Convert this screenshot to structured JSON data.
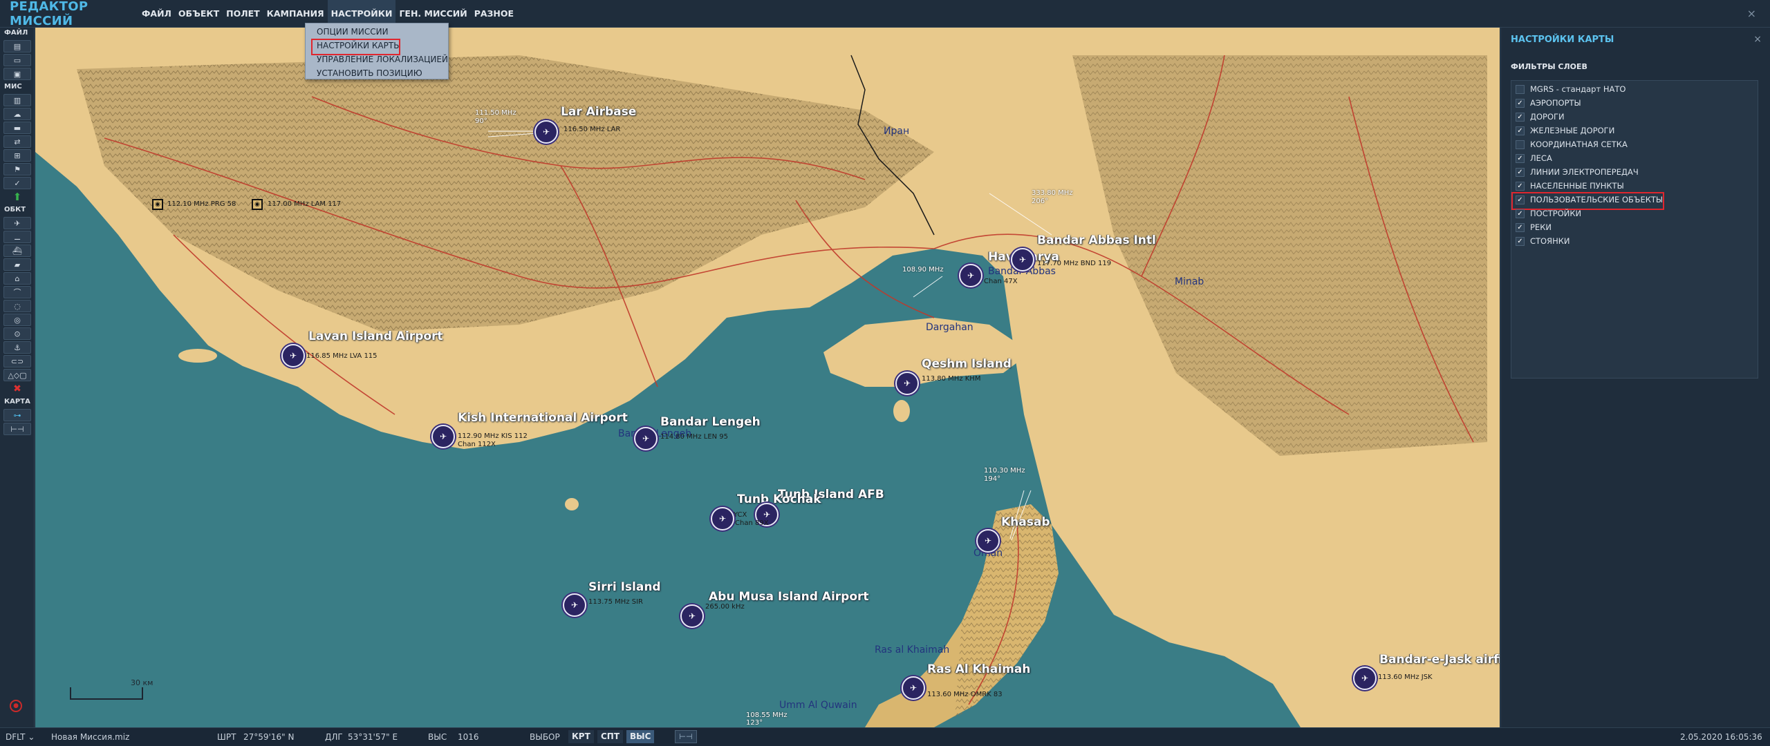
{
  "app": {
    "title": "РЕДАКТОР МИССИЙ",
    "close_glyph": "×"
  },
  "menu": {
    "items": [
      "ФАЙЛ",
      "ОБЪЕКТ",
      "ПОЛЕТ",
      "КАМПАНИЯ",
      "НАСТРОЙКИ",
      "ГЕН. МИССИЙ",
      "РАЗНОЕ"
    ],
    "active": "НАСТРОЙКИ"
  },
  "dropdown": {
    "items": [
      "ОПЦИИ МИССИИ",
      "НАСТРОЙКИ КАРТЫ",
      "УПРАВЛЕНИЕ ЛОКАЛИЗАЦИЕЙ",
      "УСТАНОВИТЬ ПОЗИЦИЮ"
    ],
    "highlighted": "НАСТРОЙКИ КАРТЫ"
  },
  "toolbar": {
    "sections": [
      {
        "label": "ФАЙЛ",
        "buttons": [
          "new-file-icon",
          "open-folder-icon",
          "save-icon"
        ]
      },
      {
        "label": "МИС",
        "buttons": [
          "trash-icon",
          "weather-icon",
          "briefing-icon",
          "trigger-icon",
          "resource-icon",
          "goal-icon",
          "check-icon"
        ]
      },
      {
        "label": "ОБКТ",
        "buttons": [
          "plane-icon",
          "helicopter-icon",
          "ship-icon",
          "tank-icon",
          "sam-icon",
          "static-icon",
          "zone-icon",
          "target-icon",
          "nav-point-icon",
          "airfield-icon",
          "link-icon",
          "shapes-icon"
        ]
      },
      {
        "label": "КАРТА",
        "buttons": [
          "map-layers-icon",
          "ruler-icon"
        ]
      }
    ],
    "glyphs": {
      "green": "⬆",
      "red": "✖",
      "shapes": "△◇▢"
    }
  },
  "map": {
    "places": [
      {
        "name": "Lar Airbase"
      },
      {
        "name": "Bandar Abbas Intl"
      },
      {
        "name": "Havadarya"
      },
      {
        "name": "Lavan Island Airport"
      },
      {
        "name": "Qeshm Island"
      },
      {
        "name": "Kish International Airport"
      },
      {
        "name": "Bandar Lengeh"
      },
      {
        "name": "Tunb Island AFB"
      },
      {
        "name": "Tunb Kochak"
      },
      {
        "name": "Khasab"
      },
      {
        "name": "Sirri Island"
      },
      {
        "name": "Abu Musa Island Airport"
      },
      {
        "name": "Ras Al Khaimah"
      },
      {
        "name": "Bandar-e-Jask airfi"
      }
    ],
    "towns": [
      {
        "name": "Иран"
      },
      {
        "name": "Dargahan"
      },
      {
        "name": "Minab"
      },
      {
        "name": "Ras al Khaimah"
      },
      {
        "name": "Umm Al Quwain"
      },
      {
        "name": "Oman"
      },
      {
        "name": "Bandar Abbas"
      },
      {
        "name": "Bandar Lengeh"
      }
    ],
    "frequencies": [
      "111.50 MHz",
      "90°",
      "116.50 MHz LAR",
      "112.10 MHz PRG 58",
      "117.00 MHz LAM 117",
      "333.80 MHz",
      "206°",
      "117.70 MHz BND 119",
      "108.90 MHz",
      "Chan 47X",
      "116.85 MHz LVA 115",
      "113.80 MHz KHM",
      "112.90 MHz KIS 112",
      "Chan 112X",
      "114.80 MHz LEN 95",
      "110.30 MHz",
      "194°",
      "Chan 89X",
      "113.75 MHz SIR",
      "265.00 kHz",
      "113.60 MHz OMRK 83",
      "108.55 MHz",
      "123°",
      "113.60 MHz JSK",
      "YCX"
    ],
    "scale_label": "30 км",
    "colors": {
      "sea": "#3a7d86",
      "land": "#e8c98c",
      "mountain": "#a9905f",
      "road": "#c0392b",
      "airport": "#2b2461"
    }
  },
  "panel": {
    "title": "НАСТРОЙКИ КАРТЫ",
    "close_glyph": "×",
    "subtitle": "ФИЛЬТРЫ СЛОЕВ",
    "check_glyph": "✓",
    "filters": [
      {
        "label": "MGRS - стандарт НАТО",
        "checked": false
      },
      {
        "label": "АЭРОПОРТЫ",
        "checked": true
      },
      {
        "label": "ДОРОГИ",
        "checked": true
      },
      {
        "label": "ЖЕЛЕЗНЫЕ ДОРОГИ",
        "checked": true
      },
      {
        "label": "КООРДИНАТНАЯ СЕТКА",
        "checked": false
      },
      {
        "label": "ЛЕСА",
        "checked": true
      },
      {
        "label": "ЛИНИИ ЭЛЕКТРОПЕРЕДАЧ",
        "checked": true
      },
      {
        "label": "НАСЕЛЕННЫЕ ПУНКТЫ",
        "checked": true
      },
      {
        "label": "ПОЛЬЗОВАТЕЛЬСКИЕ ОБЪЕКТЫ",
        "checked": true,
        "highlighted": true
      },
      {
        "label": "ПОСТРОЙКИ",
        "checked": true
      },
      {
        "label": "РЕКИ",
        "checked": true
      },
      {
        "label": "СТОЯНКИ",
        "checked": true
      }
    ]
  },
  "status": {
    "profile": "DFLT",
    "file": "Новая Миссия.miz",
    "lat_label": "ШРТ",
    "lat": "27°59'16\" N",
    "lon_label": "ДЛГ",
    "lon": "53°31'57\" E",
    "alt_label": "ВЫС",
    "alt": "1016",
    "select_label": "ВЫБОР",
    "modes": [
      "КРТ",
      "СПТ",
      "ВЫС"
    ],
    "active_mode": "ВЫС",
    "datetime": "2.05.2020 16:05:36"
  }
}
